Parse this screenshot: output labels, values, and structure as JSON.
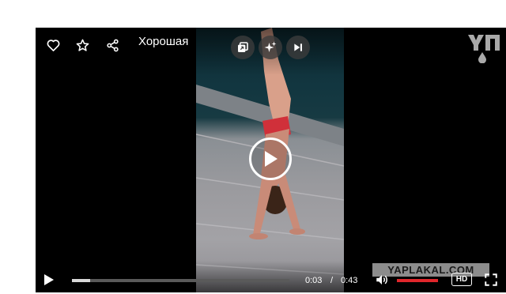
{
  "player": {
    "title": "Хорошая",
    "current_time": "0:03",
    "time_separator": "/",
    "duration": "0:43",
    "progress_fraction": 0.085,
    "volume_fraction": 1.0,
    "quality_label": "HD",
    "watermark": "YAPLAKAL.COM",
    "accent_color": "#e0262b"
  },
  "icons": {
    "like": "heart-icon",
    "favorite": "star-icon",
    "share": "share-icon",
    "pip": "picture-in-picture-icon",
    "enhance": "sparkles-icon",
    "next": "skip-next-icon",
    "logo": "yaplakal-logo",
    "play": "play-icon",
    "volume": "volume-icon",
    "fullscreen": "fullscreen-icon"
  }
}
